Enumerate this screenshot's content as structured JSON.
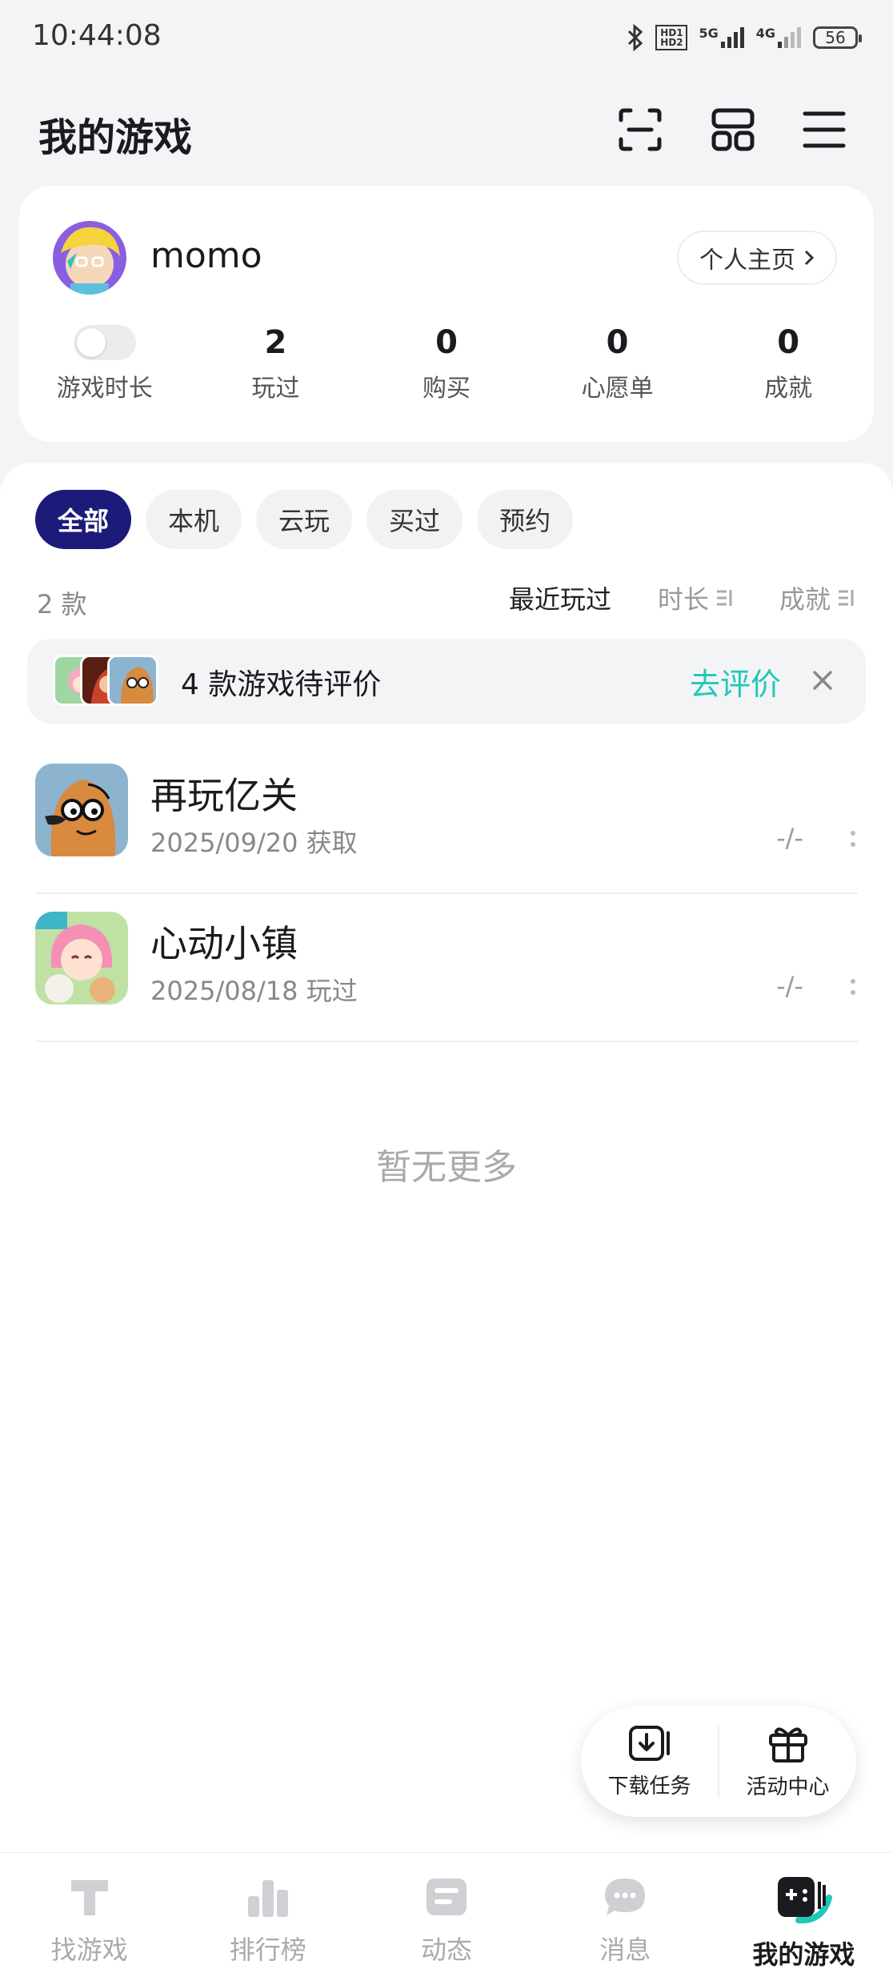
{
  "status_bar": {
    "time": "10:44:08",
    "hd_label": "HD1 HD2",
    "net1": "5G",
    "net2": "4G",
    "battery": "56"
  },
  "header": {
    "title": "我的游戏",
    "icons": [
      "scan-icon",
      "grid-icon",
      "menu-icon"
    ]
  },
  "profile": {
    "username": "momo",
    "profile_link": "个人主页",
    "stats": [
      {
        "label": "游戏时长",
        "value": ""
      },
      {
        "label": "玩过",
        "value": "2"
      },
      {
        "label": "购买",
        "value": "0"
      },
      {
        "label": "心愿单",
        "value": "0"
      },
      {
        "label": "成就",
        "value": "0"
      }
    ]
  },
  "filters": {
    "chips": [
      "全部",
      "本机",
      "云玩",
      "买过",
      "预约"
    ],
    "active": "全部"
  },
  "list_header": {
    "count": "2 款",
    "sorts": [
      "最近玩过",
      "时长",
      "成就"
    ]
  },
  "review_banner": {
    "text": "4 款游戏待评价",
    "action": "去评价"
  },
  "games": [
    {
      "name": "再玩亿关",
      "date": "2025/09/20 获取",
      "playtime": "-/-"
    },
    {
      "name": "心动小镇",
      "date": "2025/08/18 玩过",
      "playtime": "-/-"
    }
  ],
  "no_more": "暂无更多",
  "float_actions": [
    "下载任务",
    "活动中心"
  ],
  "bottom_nav": {
    "items": [
      "找游戏",
      "排行榜",
      "动态",
      "消息",
      "我的游戏"
    ],
    "active": "我的游戏"
  },
  "colors": {
    "accent": "#1d1b7a",
    "teal": "#1ec9b8",
    "background": "#f3f4f6"
  }
}
